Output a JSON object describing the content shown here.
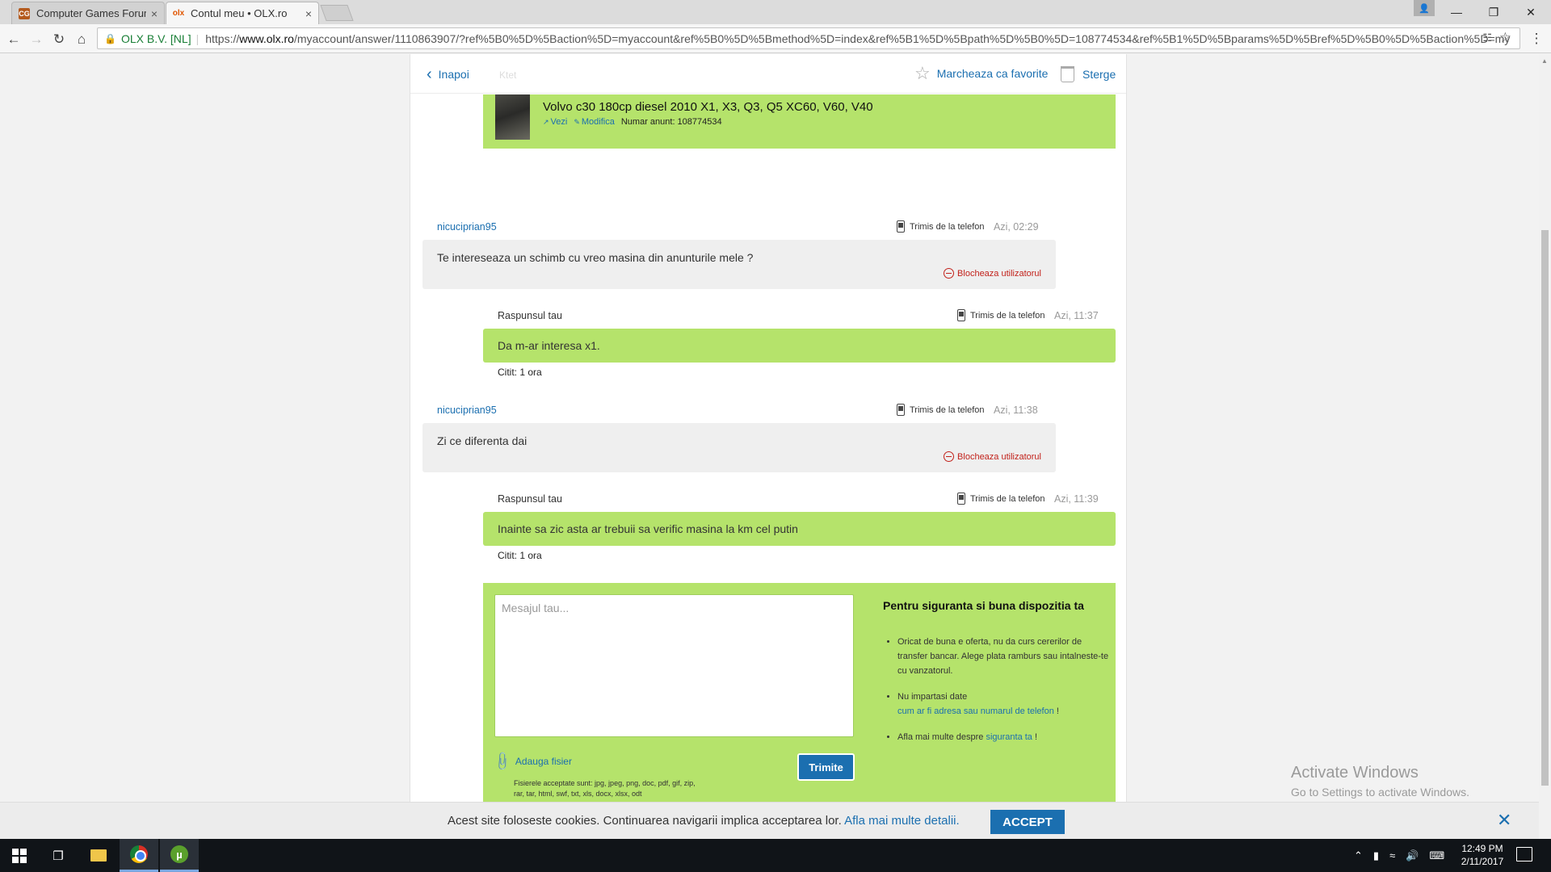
{
  "browser": {
    "tabs": [
      {
        "favicon": "CG",
        "title": "Computer Games Forum",
        "close": "×"
      },
      {
        "favicon": "olx",
        "title": "Contul meu • OLX.ro",
        "close": "×"
      }
    ],
    "window_controls": {
      "minimize": "—",
      "maximize": "❐",
      "close": "✕",
      "profile": "👤"
    },
    "address": {
      "secure_label": "OLX B.V. [NL]",
      "url_scheme": "https://",
      "url_host": "www.olx.ro",
      "url_path": "/myaccount/answer/1110863907/?ref%5B0%5D%5Baction%5D=myaccount&ref%5B0%5D%5Bmethod%5D=index&ref%5B1%5D%5Bpath%5D%5B0%5D=108774534&ref%5B1%5D%5Bparams%5D%5Bref%5D%5B0%5D%5Baction%5D=my"
    }
  },
  "panel": {
    "back_label": "Inapoi",
    "back_ghost": "Ktet",
    "favorite_label": "Marcheaza ca favorite",
    "delete_label": "Sterge"
  },
  "ad": {
    "title": "Volvo c30 180cp diesel 2010 X1, X3, Q3, Q5 XC60, V60, V40",
    "view_label": "Vezi",
    "edit_label": "Modifica",
    "ad_number": "Numar anunt: 108774534"
  },
  "messages": [
    {
      "author": "nicuciprian95",
      "source": "Trimis de la telefon",
      "time": "Azi, 02:29",
      "text": "Te intereseaza un schimb cu vreo masina din anunturile mele ?",
      "action": "Blocheaza utilizatorul"
    },
    {
      "author": "Raspunsul tau",
      "source": "Trimis de la telefon",
      "time": "Azi, 11:37",
      "text": "Da m-ar interesa x1.",
      "status": "Citit: 1 ora"
    },
    {
      "author": "nicuciprian95",
      "source": "Trimis de la telefon",
      "time": "Azi, 11:38",
      "text": "Zi ce diferenta dai",
      "action": "Blocheaza utilizatorul"
    },
    {
      "author": "Raspunsul tau",
      "source": "Trimis de la telefon",
      "time": "Azi, 11:39",
      "text": "Inainte sa zic asta ar trebuii sa verific masina la km cel putin",
      "status": "Citit: 1 ora"
    }
  ],
  "compose": {
    "placeholder": "Mesajul tau...",
    "attach_label": "Adauga fisier",
    "attach_note": "Fisierele acceptate sunt: jpg, jpeg, png, doc, pdf, gif, zip, rar, tar, html, swf, txt, xls, docx, xlsx, odt",
    "send_label": "Trimite"
  },
  "tips": {
    "title": "Pentru siguranta si buna dispozitia ta",
    "tip1": "Oricat de buna e oferta, nu da curs cererilor de transfer bancar. Alege plata ramburs sau intalneste-te cu vanzatorul.",
    "tip2_text": "Nu impartasi date",
    "tip2_link": "cum ar fi adresa sau numarul de telefon",
    "tip2_end": " !",
    "tip3_text": "Afla mai multe despre ",
    "tip3_link": "siguranta ta",
    "tip3_end": " !"
  },
  "watermark": {
    "line1": "Activate Windows",
    "line2": "Go to Settings to activate Windows."
  },
  "cookie": {
    "text": "Acest site foloseste cookies. Continuarea navigarii implica acceptarea lor. ",
    "link": "Afla mai multe detalii.",
    "accept_label": "ACCEPT",
    "close": "✕"
  },
  "taskbar": {
    "time": "12:49 PM",
    "date": "2/11/2017"
  },
  "colors": {
    "accent_blue": "#1b6fb0",
    "bubble_green": "#b5e36b",
    "bubble_grey": "#efefef",
    "block_red": "#c2221b"
  }
}
